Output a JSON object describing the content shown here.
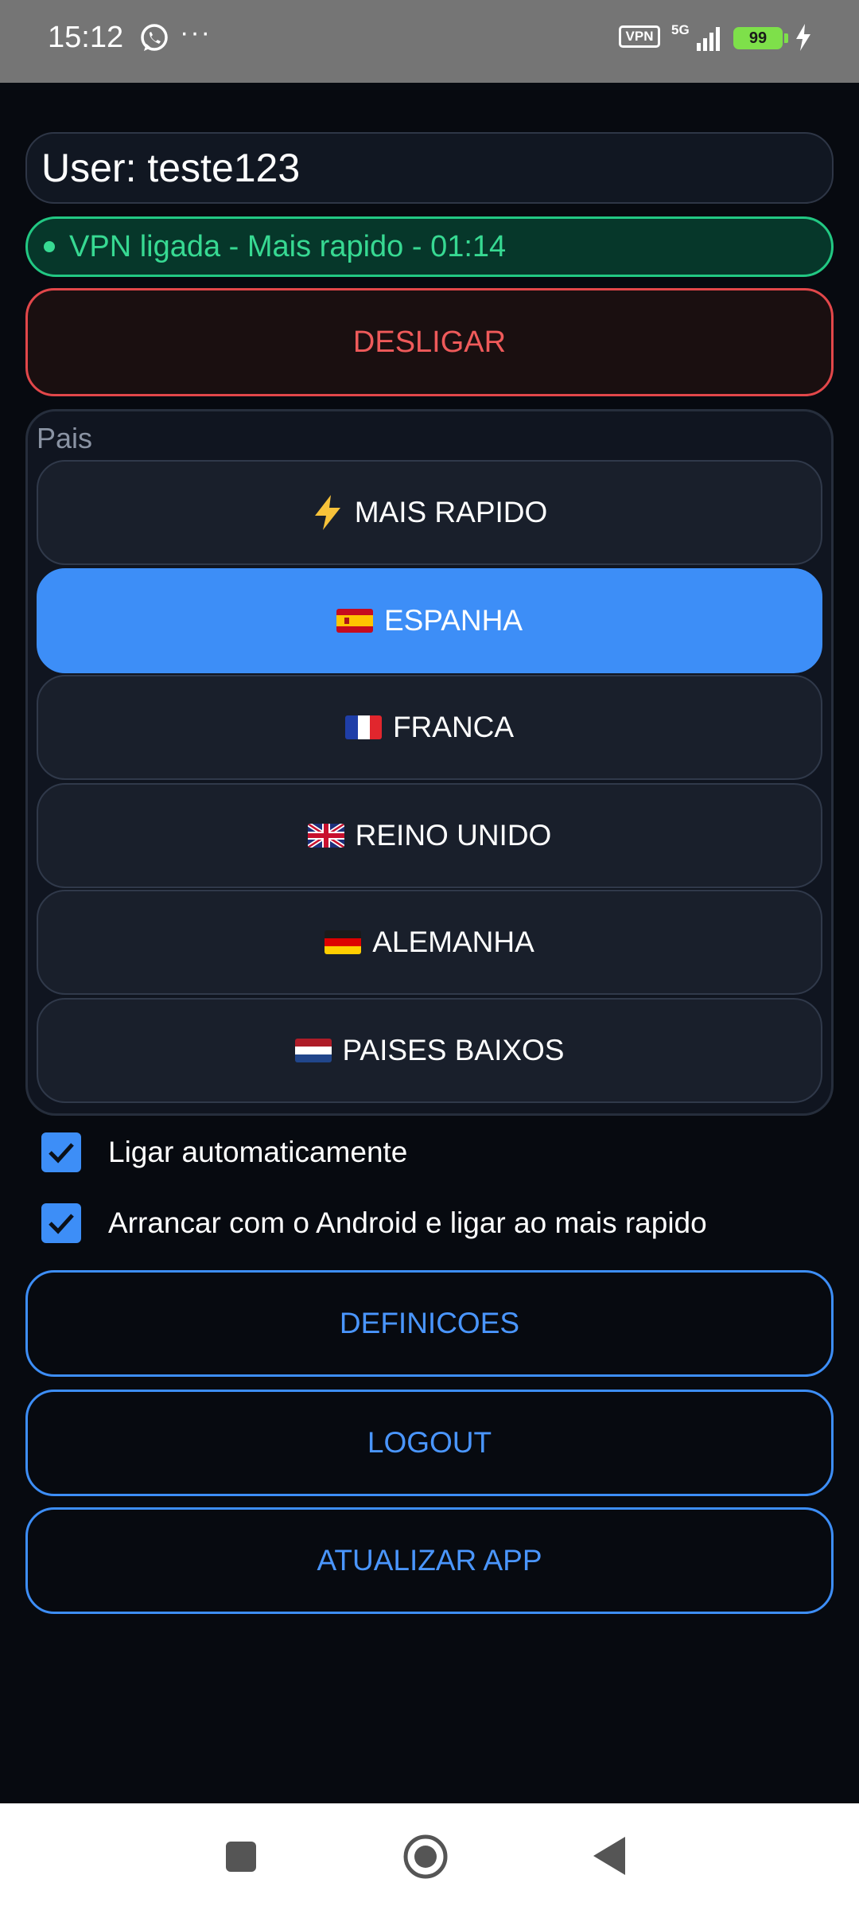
{
  "status_bar": {
    "time": "15:12",
    "more": "···",
    "vpn_badge": "VPN",
    "network": "5G",
    "battery": "99"
  },
  "user": {
    "label": "User: teste123"
  },
  "connection": {
    "status": "VPN ligada - Mais rapido - 01:14"
  },
  "disconnect_button": "DESLIGAR",
  "country_panel": {
    "label": "Pais",
    "countries": [
      {
        "label": "MAIS RAPIDO",
        "icon": "lightning-icon",
        "selected": false
      },
      {
        "label": "ESPANHA",
        "icon": "spain-flag-icon",
        "selected": true
      },
      {
        "label": "FRANCA",
        "icon": "france-flag-icon",
        "selected": false
      },
      {
        "label": "REINO UNIDO",
        "icon": "uk-flag-icon",
        "selected": false
      },
      {
        "label": "ALEMANHA",
        "icon": "germany-flag-icon",
        "selected": false
      },
      {
        "label": "PAISES BAIXOS",
        "icon": "netherlands-flag-icon",
        "selected": false
      }
    ]
  },
  "options": [
    {
      "label": "Ligar automaticamente",
      "checked": true
    },
    {
      "label": "Arrancar com o Android e ligar ao mais rapido",
      "checked": true
    }
  ],
  "actions": {
    "settings": "DEFINICOES",
    "logout": "LOGOUT",
    "update": "ATUALIZAR APP"
  },
  "colors": {
    "accent": "#3d8ef7",
    "connected": "#37d992",
    "danger": "#ef5a5a",
    "background": "#070a10"
  }
}
